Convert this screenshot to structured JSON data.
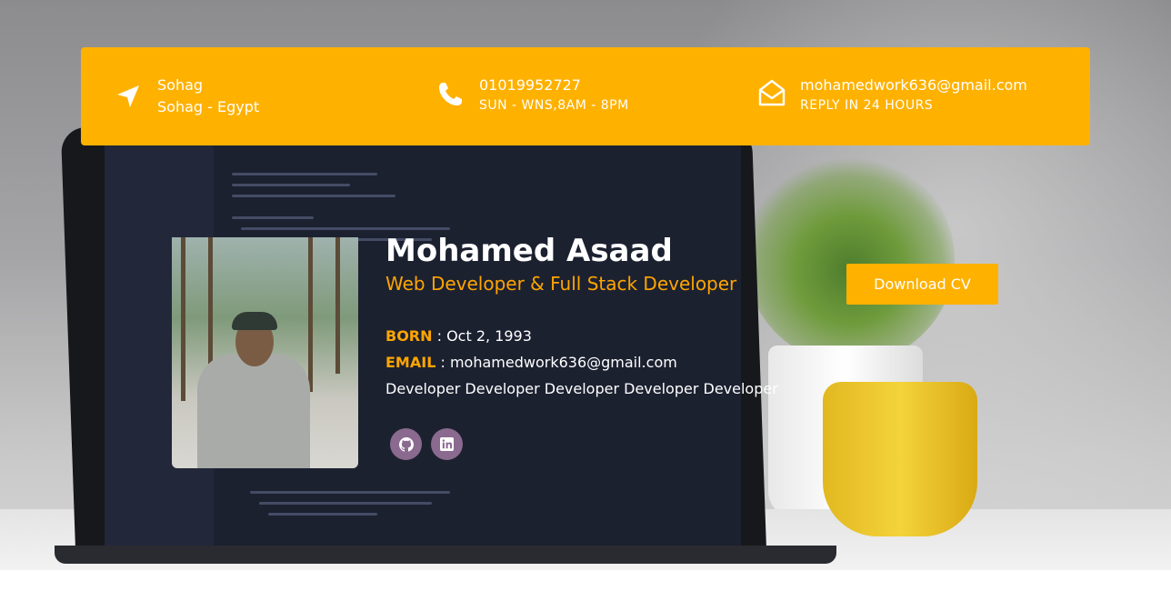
{
  "contact": {
    "location": {
      "icon": "location-arrow-icon",
      "line1": "Sohag",
      "line2": "Sohag - Egypt"
    },
    "phone": {
      "icon": "phone-icon",
      "line1": "01019952727",
      "line2": "SUN - WNS,8AM - 8PM"
    },
    "email": {
      "icon": "envelope-open-icon",
      "line1": "mohamedwork636@gmail.com",
      "line2": "REPLY IN 24 HOURS"
    }
  },
  "profile": {
    "name": "Mohamed Asaad",
    "title": "Web Developer & Full Stack Developer",
    "born_label": "BORN",
    "born_value": " : Oct 2, 1993",
    "email_label": "EMAIL",
    "email_value": " : mohamedwork636@gmail.com",
    "roles": "Developer Developer Developer Developer Developer"
  },
  "social": [
    {
      "icon": "github-icon"
    },
    {
      "icon": "linkedin-icon"
    }
  ],
  "download_label": "Download CV",
  "colors": {
    "accent": "#ffb100",
    "highlight": "#ffa500",
    "social_bg": "#8a6a8f"
  }
}
